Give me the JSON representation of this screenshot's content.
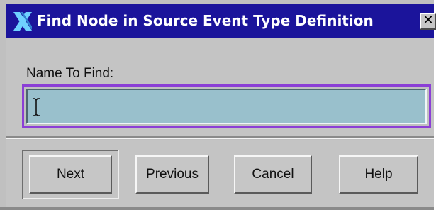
{
  "window": {
    "title": "Find Node in Source Event Type Definition",
    "close_label": "✕"
  },
  "icons": {
    "app_icon": "x-logo-icon",
    "close_icon": "close-icon",
    "cursor_icon": "text-cursor-icon"
  },
  "form": {
    "name_label": "Name To Find:",
    "name_value": "",
    "name_placeholder": ""
  },
  "buttons": {
    "next": "Next",
    "previous": "Previous",
    "cancel": "Cancel",
    "help": "Help"
  },
  "colors": {
    "titlebar": "#1b149b",
    "input_focus_border": "#8b3fd6",
    "input_background": "#99c0cc",
    "window_background": "#c4c4c4"
  }
}
